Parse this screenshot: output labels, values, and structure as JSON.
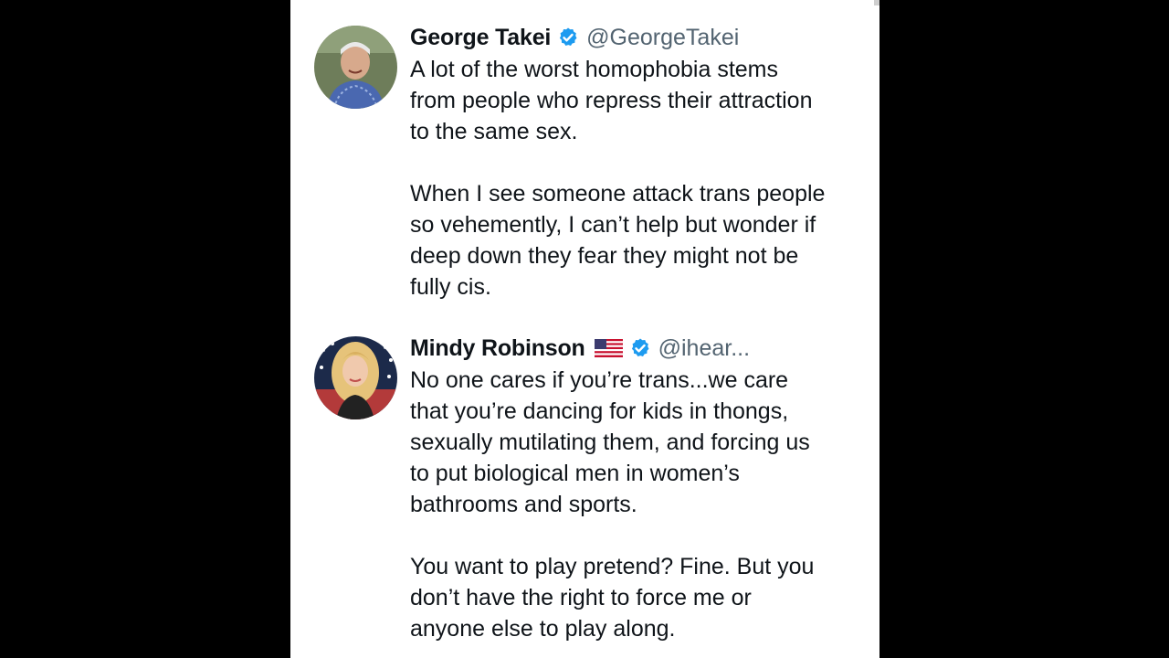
{
  "tweets": [
    {
      "name": "George Takei",
      "handle": "@GeorgeTakei",
      "verified": true,
      "avatar_icon": "profile-photo",
      "text": "A lot of the worst homophobia stems\nfrom people who repress their attraction\nto the same sex.\n\nWhen I see someone attack trans people\nso vehemently, I can’t help but wonder if\ndeep down they fear they might not be\nfully cis."
    },
    {
      "name": "Mindy Robinson",
      "flag_icon": "us-flag-icon",
      "handle": "@ihear...",
      "verified": true,
      "avatar_icon": "profile-photo",
      "text": "No one cares if you’re trans...we care\nthat you’re dancing for kids in thongs,\nsexually mutilating them, and forcing us\nto put biological men in women’s\nbathrooms and sports.\n\nYou want to play pretend? Fine. But you\ndon’t have the right to force me or\nanyone else to play along."
    }
  ],
  "colors": {
    "background": "#000000",
    "panel": "#ffffff",
    "text": "#0f1419",
    "secondary_text": "#536471",
    "verified_blue": "#1d9bf0"
  }
}
